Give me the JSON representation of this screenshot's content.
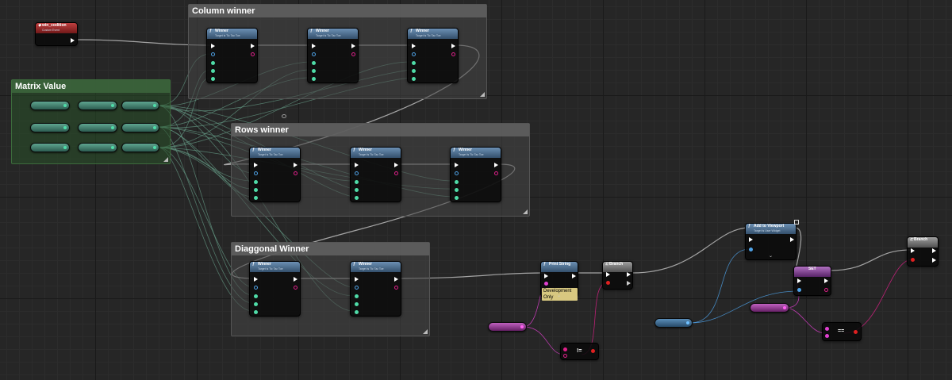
{
  "comments": {
    "column_winner": "Column winner",
    "matrix_value": "Matrix Value",
    "rows_winner": "Rows winner",
    "diaggonal_winner": "Diaggonal Winner"
  },
  "event_node": {
    "title": "win_codition",
    "subtitle": "Custom Event"
  },
  "winner_node": {
    "title": "Winner",
    "subtitle": "Target is Tic Tac Toe"
  },
  "print_string": {
    "title": "Print String",
    "dev_label": "Development Only"
  },
  "branch_label": "Branch",
  "add_to_viewport": {
    "title": "Add to Viewport",
    "subtitle": "Target is User Widget"
  },
  "set_label": "SET",
  "ops": {
    "not_equal": "!=",
    "equal": "=="
  },
  "colors": {
    "exec_pin": "#ffffff",
    "vector_pin": "#4fdca8",
    "bool_pin": "#e0208a",
    "object_pin": "#4fa3e8",
    "string_pin": "#e040d0",
    "comment_bg": "#464646"
  }
}
